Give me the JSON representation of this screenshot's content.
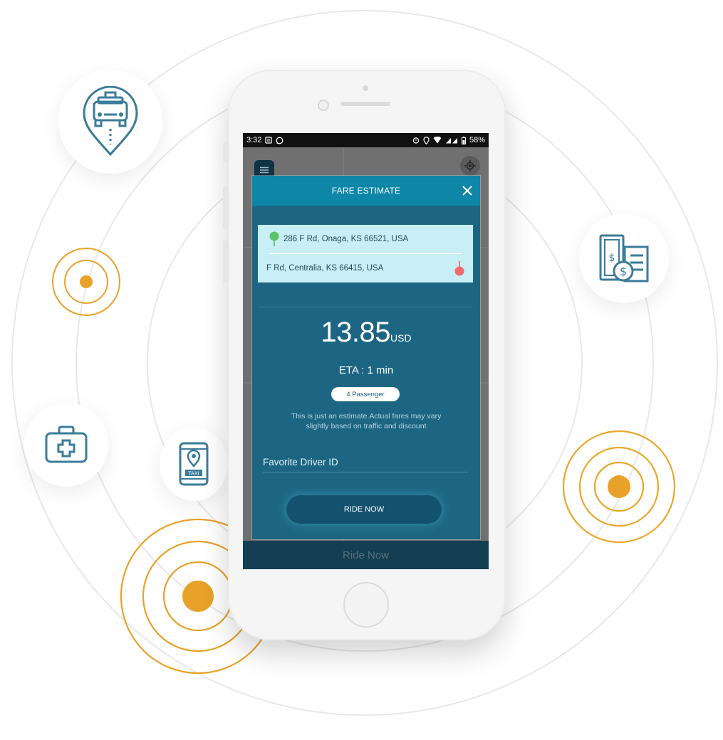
{
  "status_bar": {
    "time": "3:32",
    "battery": "58%"
  },
  "modal": {
    "title": "FARE ESTIMATE",
    "pickup_address": "286 F Rd, Onaga, KS 66521, USA",
    "drop_address": "F Rd, Centralia, KS 66415, USA",
    "fare_amount": "13.85",
    "fare_currency": "USD",
    "eta": "ETA : 1 min",
    "passenger": "4 Passenger",
    "disclaimer_line1": "This is just an estimate.Actual fares may vary",
    "disclaimer_line2": "slightly based on traffic and discount",
    "favorite_driver_placeholder": "Favorite Driver ID",
    "ride_now_button": "RIDE NOW"
  },
  "bottom_bar": {
    "label": "Ride Now"
  },
  "colors": {
    "modal_header": "#0e86a8",
    "modal_body": "#1c6683",
    "address_card": "#c8eef6",
    "pickup_pin": "#5cc46a",
    "drop_pin": "#ef6b6b",
    "accent_orange": "#e8a22a",
    "icon_blue": "#3a7c99"
  },
  "decorative_icons": [
    "taxi-location-icon",
    "money-bill-icon",
    "first-aid-kit-icon",
    "mobile-taxi-app-icon",
    "signal-target-icon"
  ]
}
